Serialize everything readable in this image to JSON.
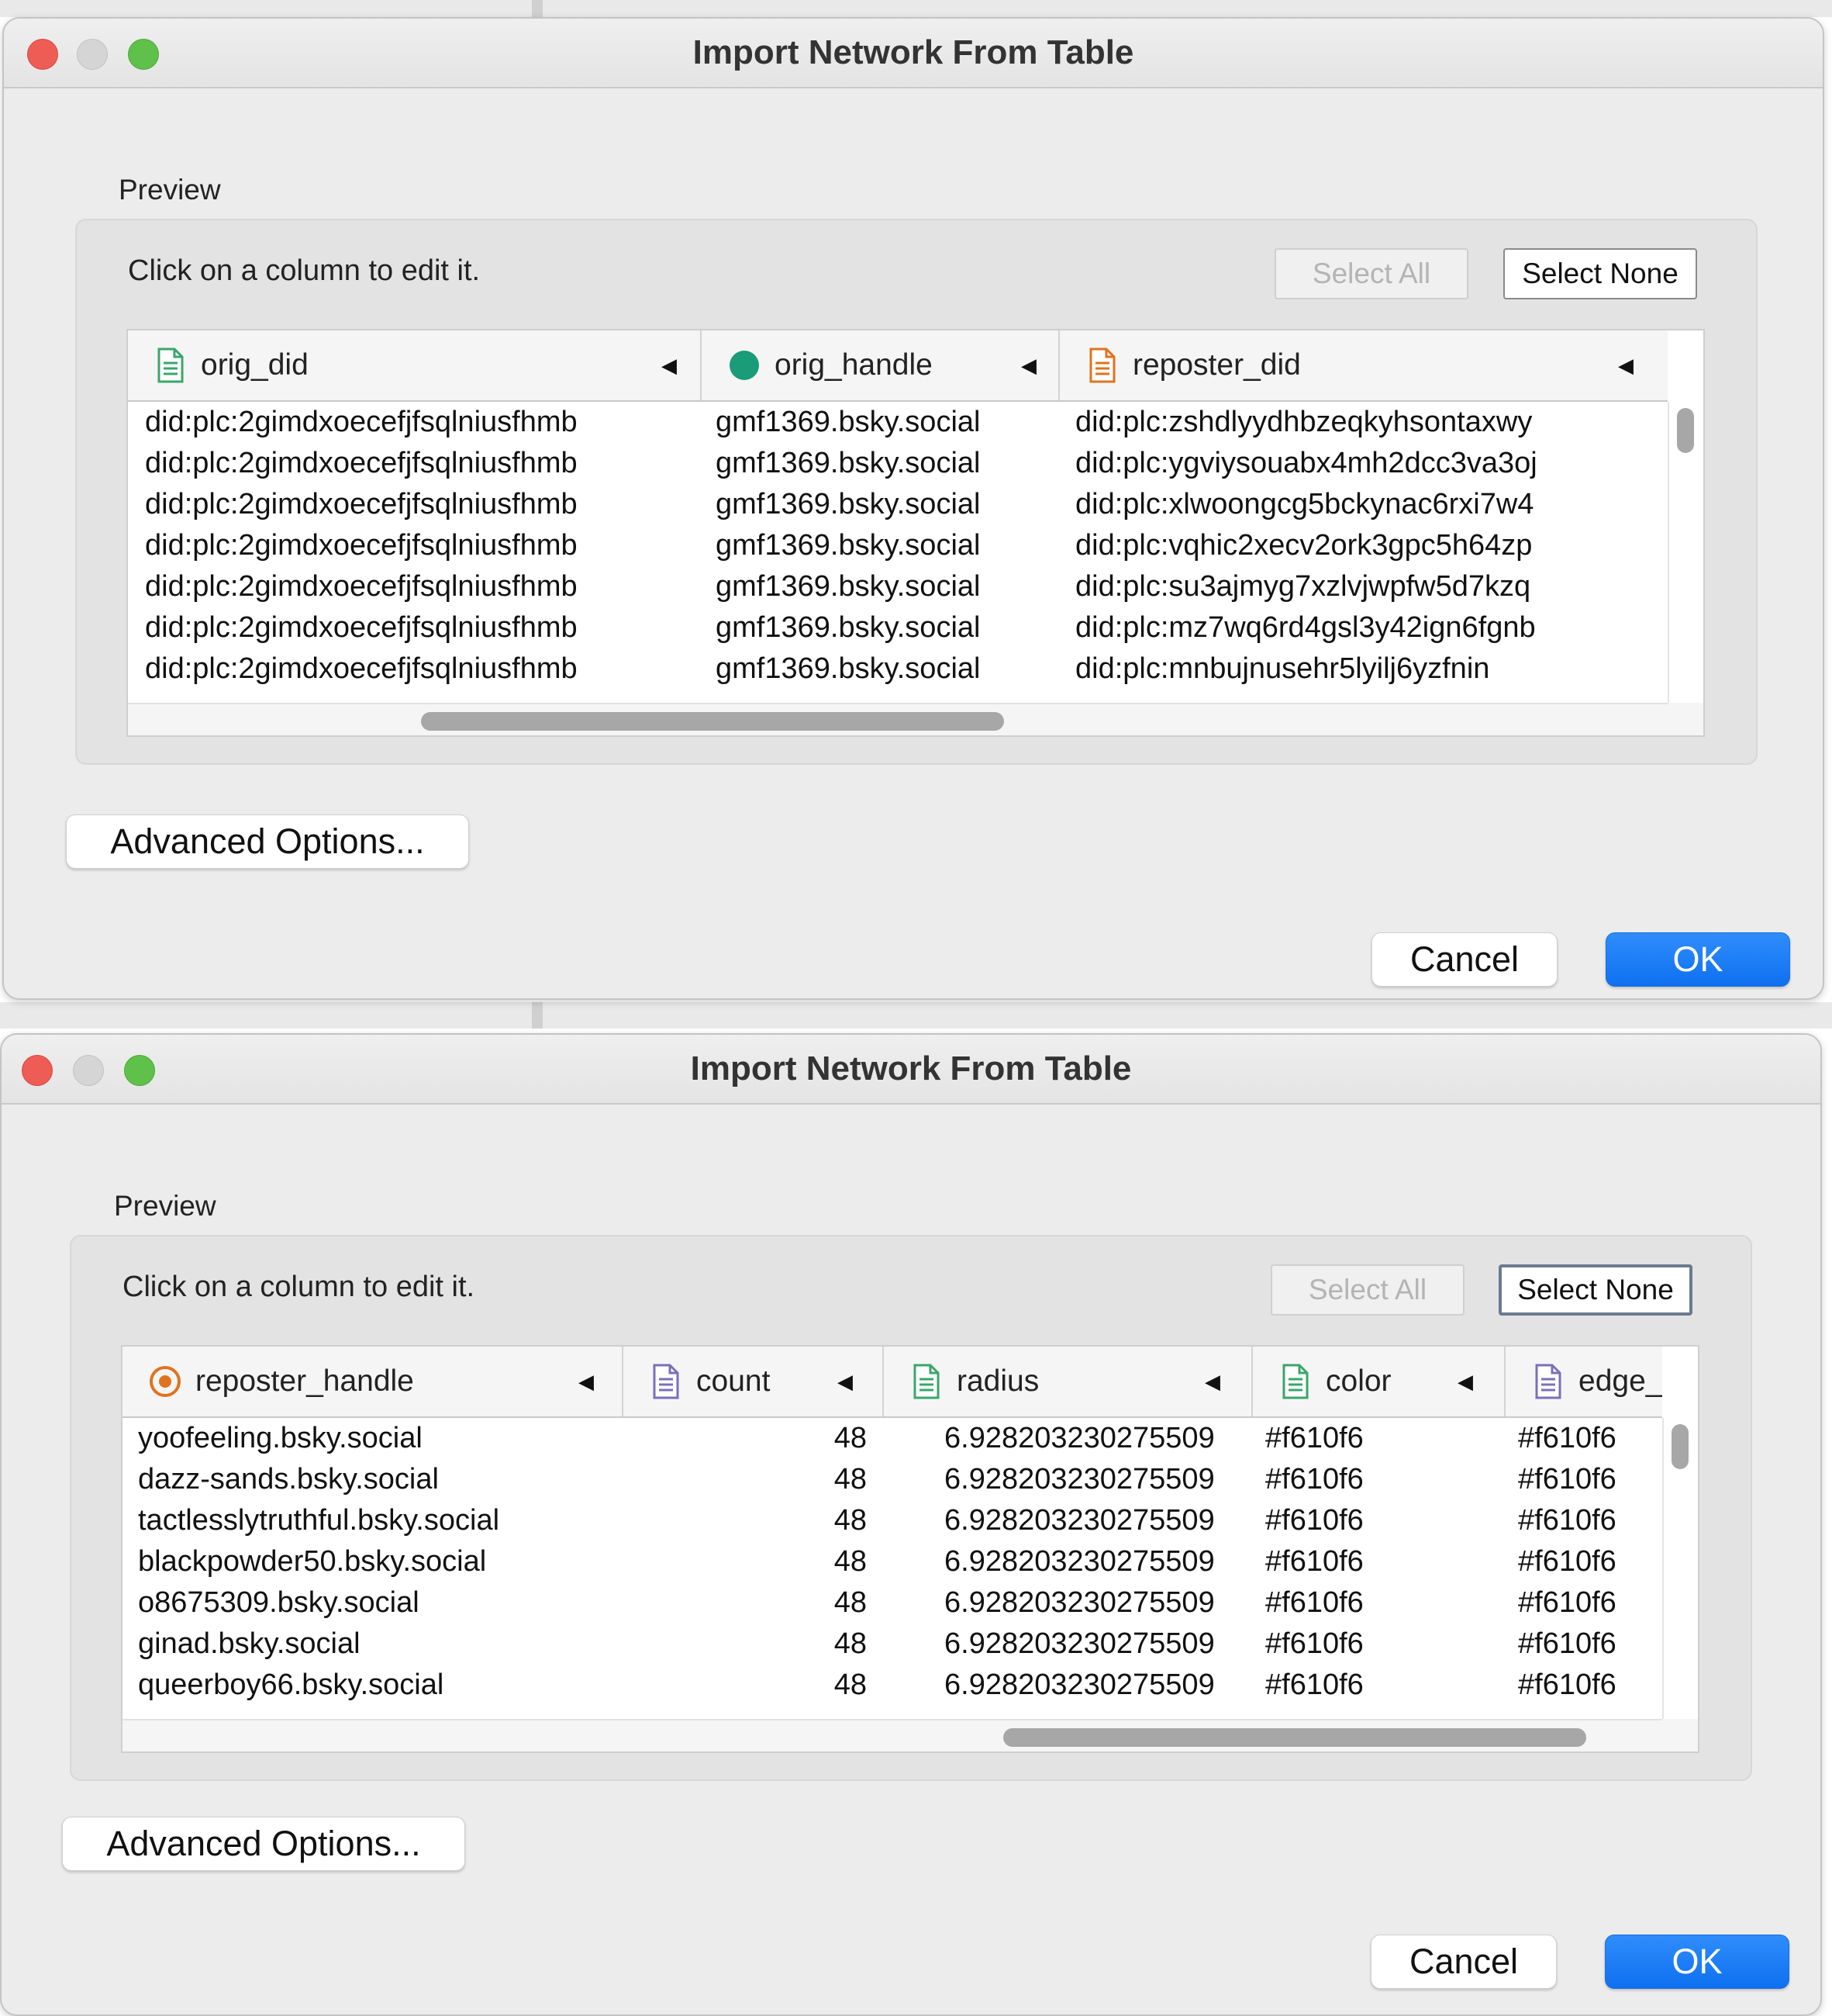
{
  "colors": {
    "text_icon": "#3aa66b",
    "key_icon": "#1a9c78",
    "orange_icon": "#e0731f",
    "purple_icon": "#7c6fb8",
    "ok_button": "#1273ef",
    "traffic_close": "#ee5d55",
    "traffic_max": "#5fc04a"
  },
  "dialogs": [
    {
      "title": "Import Network From Table",
      "preview_label": "Preview",
      "hint": "Click on a column to edit it.",
      "select_all": "Select All",
      "select_none": "Select None",
      "advanced": "Advanced Options...",
      "cancel": "Cancel",
      "ok": "OK",
      "columns": [
        {
          "name": "orig_did",
          "icon": "text-file-icon"
        },
        {
          "name": "orig_handle",
          "icon": "key-dot-icon"
        },
        {
          "name": "reposter_did",
          "icon": "text-file-orange-icon"
        }
      ],
      "rows": [
        [
          "did:plc:2gimdxoecefjfsqlniusfhmb",
          "gmf1369.bsky.social",
          "did:plc:zshdlyydhbzeqkyhsontaxwy"
        ],
        [
          "did:plc:2gimdxoecefjfsqlniusfhmb",
          "gmf1369.bsky.social",
          "did:plc:ygviysouabx4mh2dcc3va3oj"
        ],
        [
          "did:plc:2gimdxoecefjfsqlniusfhmb",
          "gmf1369.bsky.social",
          "did:plc:xlwoongcg5bckynac6rxi7w4"
        ],
        [
          "did:plc:2gimdxoecefjfsqlniusfhmb",
          "gmf1369.bsky.social",
          "did:plc:vqhic2xecv2ork3gpc5h64zp"
        ],
        [
          "did:plc:2gimdxoecefjfsqlniusfhmb",
          "gmf1369.bsky.social",
          "did:plc:su3ajmyg7xzlvjwpfw5d7kzq"
        ],
        [
          "did:plc:2gimdxoecefjfsqlniusfhmb",
          "gmf1369.bsky.social",
          "did:plc:mz7wq6rd4gsl3y42ign6fgnb"
        ],
        [
          "did:plc:2gimdxoecefjfsqlniusfhmb",
          "gmf1369.bsky.social",
          "did:plc:mnbujnusehr5lyilj6yzfnin"
        ]
      ]
    },
    {
      "title": "Import Network From Table",
      "preview_label": "Preview",
      "hint": "Click on a column to edit it.",
      "select_all": "Select All",
      "select_none": "Select None",
      "advanced": "Advanced Options...",
      "cancel": "Cancel",
      "ok": "OK",
      "columns": [
        {
          "name": "reposter_handle",
          "icon": "target-icon"
        },
        {
          "name": "count",
          "icon": "text-file-purple-icon"
        },
        {
          "name": "radius",
          "icon": "text-file-icon"
        },
        {
          "name": "color",
          "icon": "text-file-icon"
        },
        {
          "name": "edge_",
          "icon": "text-file-purple-icon"
        }
      ],
      "rows": [
        [
          "yoofeeling.bsky.social",
          "48",
          "6.928203230275509",
          "#f610f6",
          "#f610f6"
        ],
        [
          "dazz-sands.bsky.social",
          "48",
          "6.928203230275509",
          "#f610f6",
          "#f610f6"
        ],
        [
          "tactlesslytruthful.bsky.social",
          "48",
          "6.928203230275509",
          "#f610f6",
          "#f610f6"
        ],
        [
          "blackpowder50.bsky.social",
          "48",
          "6.928203230275509",
          "#f610f6",
          "#f610f6"
        ],
        [
          "o8675309.bsky.social",
          "48",
          "6.928203230275509",
          "#f610f6",
          "#f610f6"
        ],
        [
          "ginad.bsky.social",
          "48",
          "6.928203230275509",
          "#f610f6",
          "#f610f6"
        ],
        [
          "queerboy66.bsky.social",
          "48",
          "6.928203230275509",
          "#f610f6",
          "#f610f6"
        ]
      ]
    }
  ]
}
